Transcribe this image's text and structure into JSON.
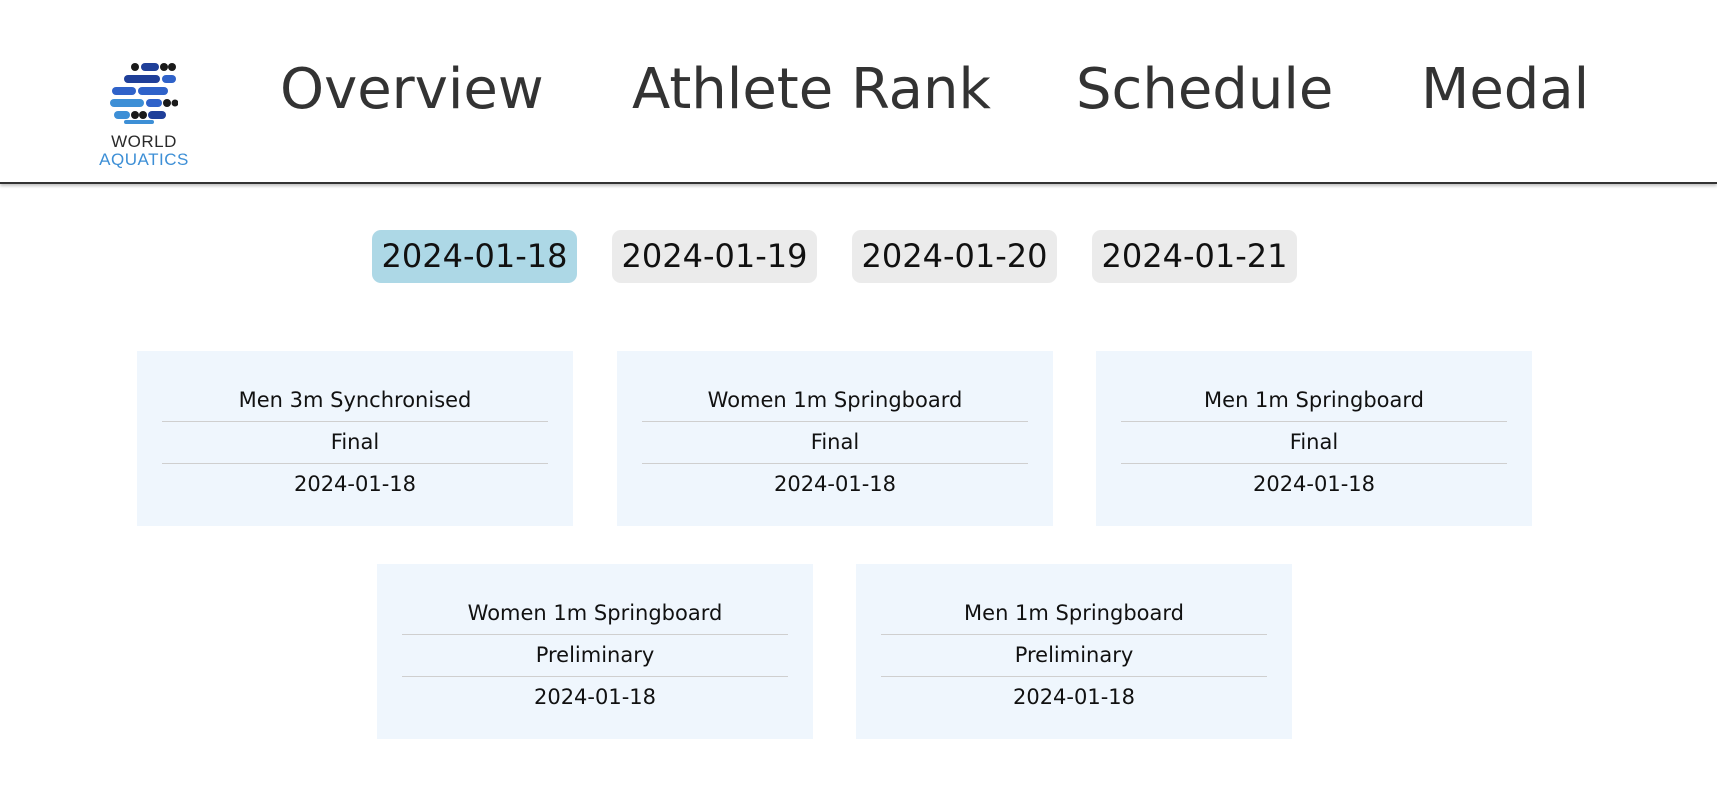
{
  "logo": {
    "line1": "WORLD",
    "line2": "AQUATICS",
    "icon": "world-aquatics-logo-icon",
    "colors": {
      "dark": "#1a1a1a",
      "navy": "#1f3f99",
      "blue": "#2f62c9",
      "light_blue": "#3d8fd6"
    }
  },
  "nav": {
    "items": [
      {
        "label": "Overview"
      },
      {
        "label": "Athlete Rank"
      },
      {
        "label": "Schedule"
      },
      {
        "label": "Medal"
      }
    ]
  },
  "date_tabs": {
    "selected": "2024-01-18",
    "active_color": "#add8e6",
    "inactive_color": "#ebebeb",
    "items": [
      {
        "label": "2024-01-18"
      },
      {
        "label": "2024-01-19"
      },
      {
        "label": "2024-01-20"
      },
      {
        "label": "2024-01-21"
      }
    ]
  },
  "events": {
    "card_color": "#eff6fd",
    "items": [
      {
        "name": "Men 3m Synchronised",
        "stage": "Final",
        "date": "2024-01-18"
      },
      {
        "name": "Women 1m Springboard",
        "stage": "Final",
        "date": "2024-01-18"
      },
      {
        "name": "Men 1m Springboard",
        "stage": "Final",
        "date": "2024-01-18"
      },
      {
        "name": "Women 1m Springboard",
        "stage": "Preliminary",
        "date": "2024-01-18"
      },
      {
        "name": "Men 1m Springboard",
        "stage": "Preliminary",
        "date": "2024-01-18"
      }
    ]
  }
}
